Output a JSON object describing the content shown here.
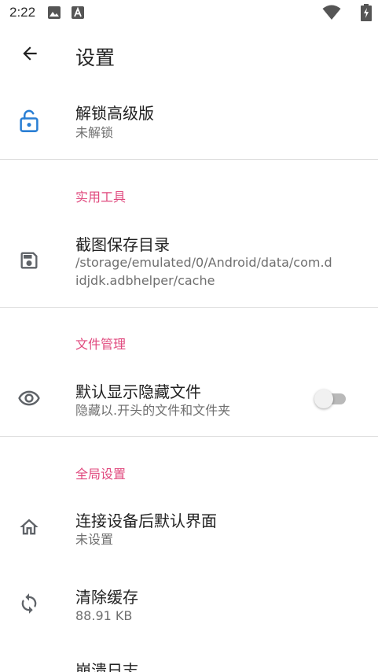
{
  "status_bar": {
    "time": "2:22",
    "icons": [
      "image-icon",
      "a-badge-icon",
      "wifi-icon",
      "battery-charging-icon"
    ]
  },
  "app_bar": {
    "title": "设置",
    "back_icon": "arrow-back-icon"
  },
  "colors": {
    "accent": "#e0497e",
    "unlock_icon": "#2a7fd4",
    "icon_gray": "#5f6368",
    "divider": "#dcdcdc"
  },
  "prefs": {
    "unlock": {
      "title": "解锁高级版",
      "summary": "未解锁",
      "icon": "lock-open-icon"
    },
    "cat_tools": "实用工具",
    "screenshot_dir": {
      "title": "截图保存目录",
      "summary": "/storage/emulated/0/Android/data/com.didjdk.adbhelper/cache",
      "icon": "save-icon"
    },
    "cat_files": "文件管理",
    "show_hidden": {
      "title": "默认显示隐藏文件",
      "summary": "隐藏以.开头的文件和文件夹",
      "icon": "eye-icon",
      "enabled": false
    },
    "cat_global": "全局设置",
    "default_screen": {
      "title": "连接设备后默认界面",
      "summary": "未设置",
      "icon": "home-icon"
    },
    "clear_cache": {
      "title": "清除缓存",
      "summary": "88.91 KB",
      "icon": "sync-icon"
    },
    "crash_log": {
      "title": "崩溃日志"
    }
  }
}
